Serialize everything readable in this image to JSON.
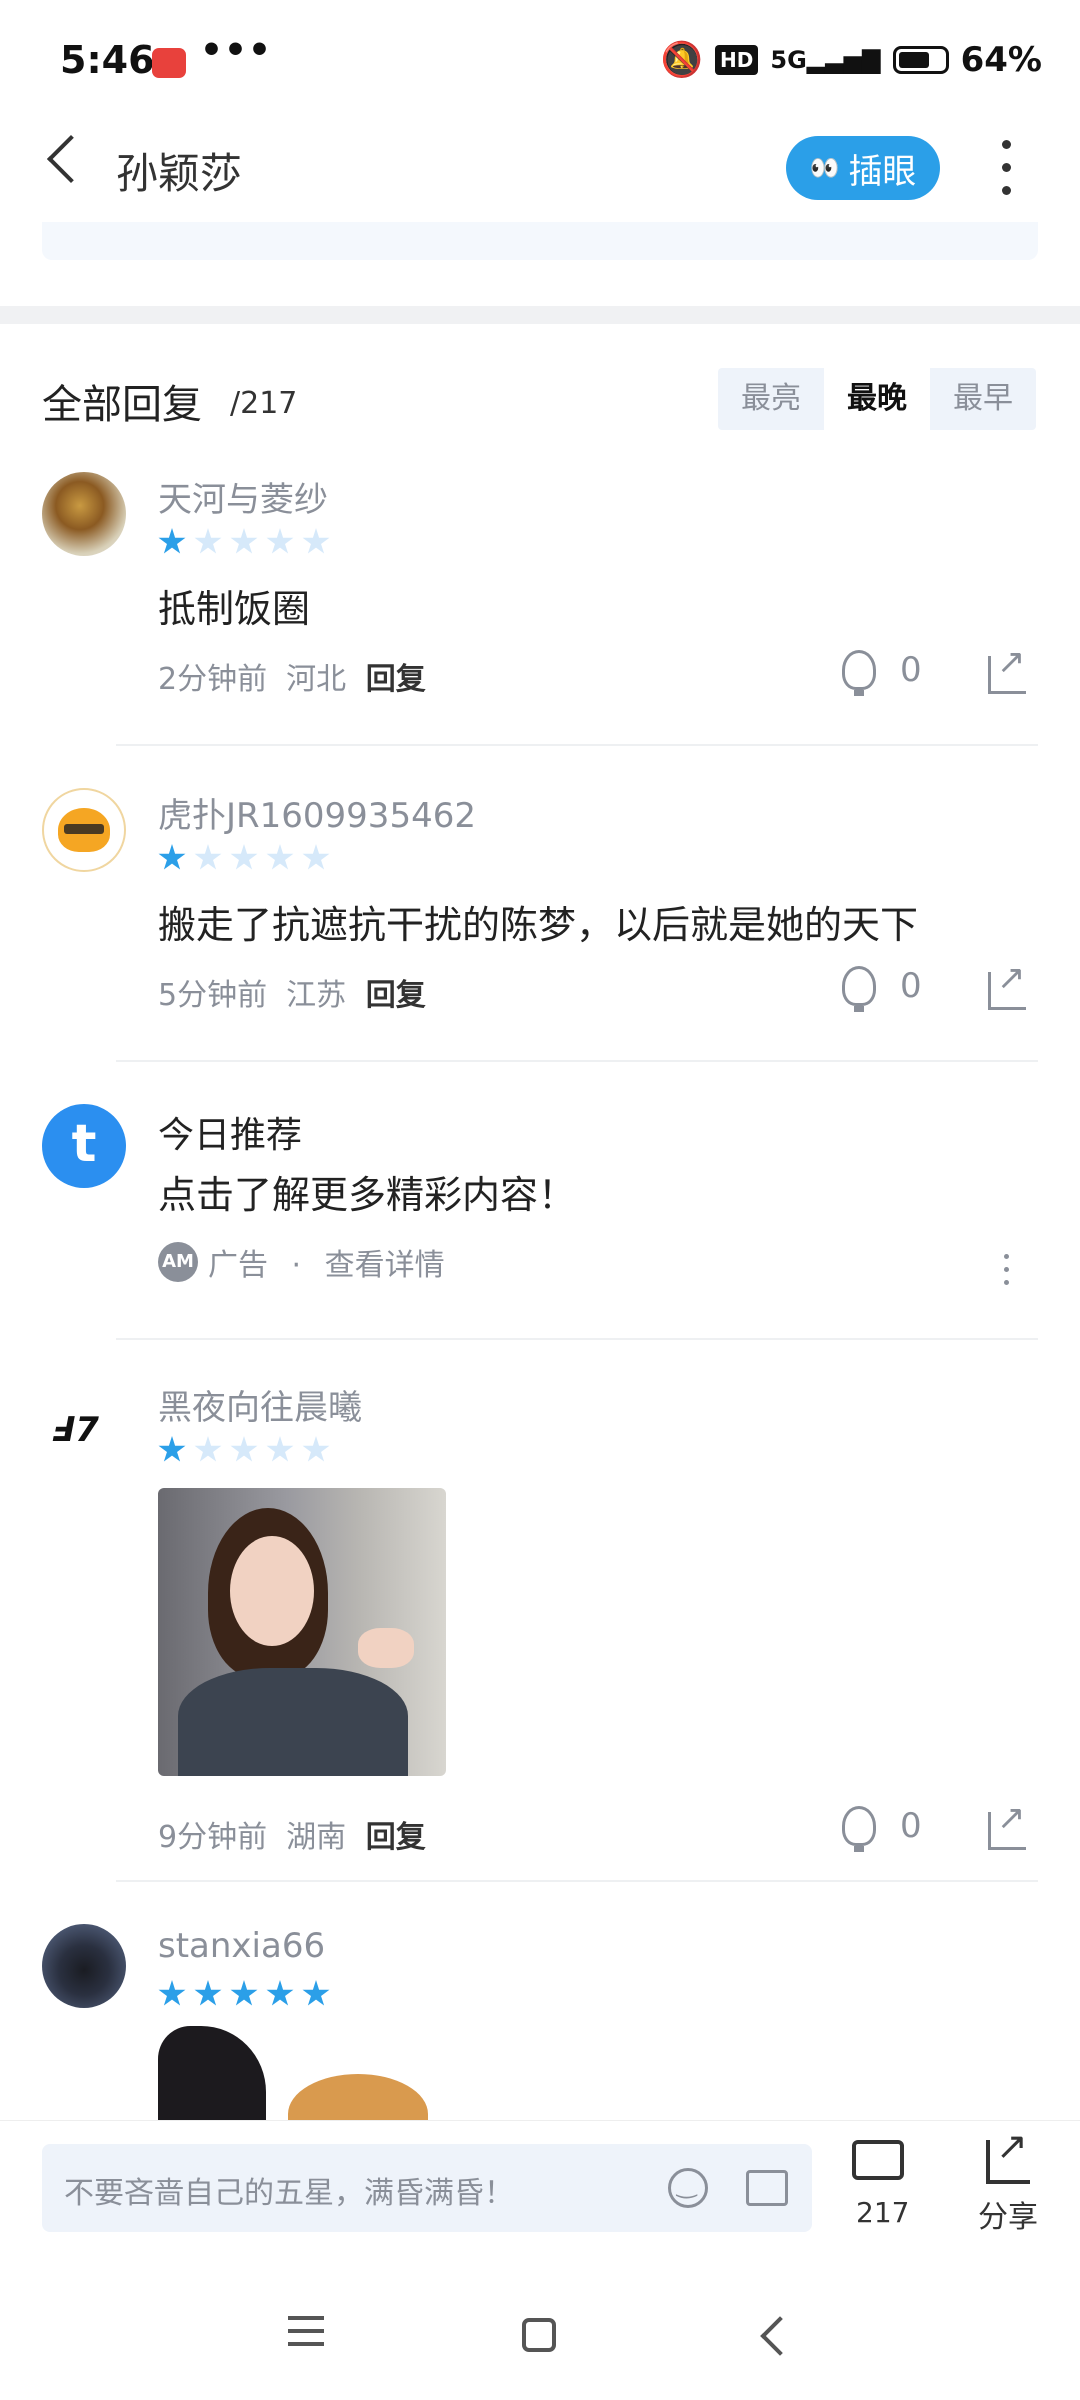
{
  "status_bar": {
    "time": "5:46",
    "dots": "•••",
    "hd": "HD",
    "network": "5G",
    "battery": "64%"
  },
  "header": {
    "title": "孙颖莎",
    "peek_label": "插眼"
  },
  "replies": {
    "heading": "全部回复",
    "count": "/217",
    "sort_options": [
      "最亮",
      "最晚",
      "最早"
    ],
    "active_sort": "最晚"
  },
  "comments": [
    {
      "username": "天河与菱纱",
      "stars": 1,
      "text": "抵制饭圈",
      "time": "2分钟前",
      "location": "河北",
      "reply": "回复",
      "likes": "0"
    },
    {
      "username": "虎扑JR1609935462",
      "stars": 1,
      "text": "搬走了抗遮抗干扰的陈梦，以后就是她的天下",
      "time": "5分钟前",
      "location": "江苏",
      "reply": "回复",
      "likes": "0"
    },
    {
      "username": "黑夜向往晨曦",
      "stars": 1,
      "text": "",
      "time": "9分钟前",
      "location": "湖南",
      "reply": "回复",
      "likes": "0"
    },
    {
      "username": "stanxia66",
      "stars": 5
    }
  ],
  "ad": {
    "title": "今日推荐",
    "text": "点击了解更多精彩内容！",
    "badge": "AM",
    "label": "广告",
    "sep": "·",
    "detail": "查看详情"
  },
  "bottom_bar": {
    "placeholder": "不要吝啬自己的五星，满昏满昏！",
    "comment_count": "217",
    "share_label": "分享"
  },
  "colors": {
    "accent": "#2b9fe8",
    "star_empty": "#d6e9fa"
  }
}
